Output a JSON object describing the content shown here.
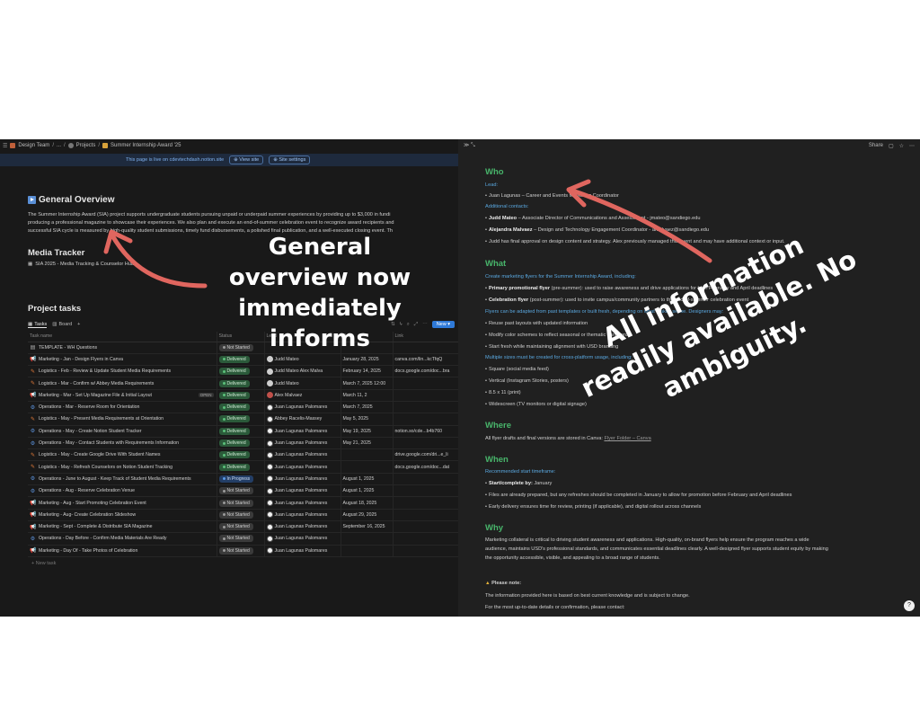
{
  "breadcrumb": [
    "Design Team",
    "...",
    "Projects",
    "Summer Internship Award '25"
  ],
  "live_banner": {
    "text": "This page is live on cdevtechdash.notion.site",
    "view_site": "View site",
    "site_settings": "Site settings"
  },
  "overview": {
    "title": "General Overview",
    "lines": [
      "The Summer Internship Award (SIA) project supports undergraduate students pursuing unpaid or underpaid summer experiences by providing up to $3,000 in fundi",
      "producing a professional magazine to showcase their experiences. We also plan and execute an end-of-summer celebration event to recognize award recipients and",
      "successful SIA cycle is measured by high-quality student submissions, timely fund disbursements, a polished final publication, and a well-executed closing event. Th"
    ]
  },
  "media": {
    "title": "Media Tracker",
    "link": "SIA 2025 - Media Tracking & Counselor Hub"
  },
  "tasks": {
    "title": "Project tasks",
    "tabs": [
      "Tasks",
      "Board",
      "+"
    ],
    "new_button": "New",
    "columns": [
      "Task name",
      "Status",
      "Lead",
      "Due",
      "Link"
    ],
    "rows": [
      {
        "icon": "doc",
        "name": "TEMPLATE - WH Questions",
        "status": "Not Started",
        "lead": "",
        "due": "",
        "link": ""
      },
      {
        "icon": "mega",
        "name": "Marketing - Jan - Design Flyers in Canva",
        "status": "Delivered",
        "lead": "Judd Mateo",
        "due": "January 28, 2025",
        "link": "canva.com/lin...kcTfqQ"
      },
      {
        "icon": "ham",
        "name": "Logistics - Feb - Review & Update Student Media Requirements",
        "status": "Delivered",
        "lead": "Judd Mateo   Alex Malva",
        "due": "February 14, 2025",
        "link": "docs.google.com/doc...bra"
      },
      {
        "icon": "ham",
        "name": "Logistics - Mar - Confirm w/ Abbey Media Requirements",
        "status": "Delivered",
        "lead": "Judd Mateo",
        "due": "March 7, 2025 12:00",
        "link": ""
      },
      {
        "icon": "mega",
        "name": "Marketing - Mar - Set Up Magazine File & Initial Layout",
        "status": "Delivered",
        "lead": "Alex Malvaez",
        "due": "March 11, 2",
        "link": ""
      },
      {
        "icon": "gear",
        "name": "Operations - Mar - Reserve Room for Orientation",
        "status": "Delivered",
        "lead": "Juan Lagunas Palomares",
        "due": "March 7, 2025",
        "link": ""
      },
      {
        "icon": "ham",
        "name": "Logistics - May - Present Media Requirements at Orientation",
        "status": "Delivered",
        "lead": "Abbey Racelis-Massey",
        "due": "May 5, 2025",
        "link": ""
      },
      {
        "icon": "gear",
        "name": "Operations - May - Create Notion Student Tracker",
        "status": "Delivered",
        "lead": "Juan Lagunas Palomares",
        "due": "May 19, 2025",
        "link": "notion.so/cde...b4b760"
      },
      {
        "icon": "gear",
        "name": "Operations - May - Contact Students with Requirements Information",
        "status": "Delivered",
        "lead": "Juan Lagunas Palomares",
        "due": "May 21, 2025",
        "link": ""
      },
      {
        "icon": "ham",
        "name": "Logistics - May - Create Google Drive With Student Names",
        "status": "Delivered",
        "lead": "Juan Lagunas Palomares",
        "due": "",
        "link": "drive.google.com/dri...e_li"
      },
      {
        "icon": "ham",
        "name": "Logistics - May - Refresh Counselors on Notion Student Tracking",
        "status": "Delivered",
        "lead": "Juan Lagunas Palomares",
        "due": "",
        "link": "docs.google.com/doc...dat"
      },
      {
        "icon": "gear",
        "name": "Operations - June to August - Keep Track of Student Media Requirements",
        "status": "In Progress",
        "lead": "Juan Lagunas Palomares",
        "due": "August 1, 2025",
        "link": ""
      },
      {
        "icon": "gear",
        "name": "Operations - Aug - Reserve Celebration Venue",
        "status": "Not Started",
        "lead": "Juan Lagunas Palomares",
        "due": "August 1, 2025",
        "link": ""
      },
      {
        "icon": "mega",
        "name": "Marketing - Aug - Start Promoting Celebration Event",
        "status": "Not Started",
        "lead": "Juan Lagunas Palomares",
        "due": "August 18, 2025",
        "link": ""
      },
      {
        "icon": "mega",
        "name": "Marketing - Aug- Create Celebration Slideshow",
        "status": "Not Started",
        "lead": "Juan Lagunas Palomares",
        "due": "August 29, 2025",
        "link": ""
      },
      {
        "icon": "mega",
        "name": "Marketing - Sept - Complete & Distribute SIA Magazine",
        "status": "Not Started",
        "lead": "Juan Lagunas Palomares",
        "due": "September 16, 2025",
        "link": ""
      },
      {
        "icon": "gear",
        "name": "Operations - Day Before - Confirm Media Materials Are Ready",
        "status": "Not Started",
        "lead": "Juan Lagunas Palomares",
        "due": "",
        "link": ""
      },
      {
        "icon": "mega",
        "name": "Marketing - Day Of - Take Photos of Celebration",
        "status": "Not Started",
        "lead": "Juan Lagunas Palomares",
        "due": "",
        "link": ""
      }
    ],
    "new_task": "+ New task",
    "open_chip": "OPEN"
  },
  "topright": {
    "share": "Share"
  },
  "who": {
    "title": "Who",
    "lead_label": "Lead:",
    "lead": "Juan Lagunas – Career and Events Marketing Coordinator",
    "contacts_label": "Additional contacts:",
    "contacts": [
      {
        "name": "Judd Mateo",
        "rest": " – Associate Director of Communications and Assessment - jmateo@sandiego.edu"
      },
      {
        "name": "Alejandra Malvaez",
        "rest": " – Design and Technology Engagement Coordinator - amalvaez@sandiego.edu"
      },
      {
        "name": "",
        "rest": "Judd has final approval on design content and strategy. Alex previously managed this event and may have additional context or input."
      }
    ]
  },
  "what": {
    "title": "What",
    "create_label": "Create marketing flyers for the Summer Internship Award, including:",
    "flyers": [
      {
        "name": "Primary promotional flyer",
        "rest": " (pre-summer): used to raise awareness and drive applications for both February and April deadlines"
      },
      {
        "name": "Celebration flyer",
        "rest": " (post-summer): used to invite campus/community partners to the end-of-summer celebration event"
      }
    ],
    "adapt_label": "Flyers can be adapted from past templates or built fresh, depending on what makes sense. Designers may:",
    "adapt": [
      "Reuse past layouts with updated information",
      "Modify color schemes to reflect seasonal or thematic variations",
      "Start fresh while maintaining alignment with USD branding"
    ],
    "sizes_label": "Multiple sizes must be created for cross-platform usage, including:",
    "sizes": [
      "Square (social media feed)",
      "Vertical (Instagram Stories, posters)",
      "8.5 x 11 (print)",
      "Widescreen (TV monitors or digital signage)"
    ]
  },
  "where": {
    "title": "Where",
    "text": "All flyer drafts and final versions are stored in Canva: ",
    "link": "Flyer Folder – Canva"
  },
  "when": {
    "title": "When",
    "label": "Recommended start timeframe:",
    "items": [
      {
        "name": "Start/complete by:",
        "rest": " January"
      },
      {
        "name": "",
        "rest": "Files are already prepared, but any refreshes should be completed in January to allow for promotion before February and April deadlines"
      },
      {
        "name": "",
        "rest": "Early delivery ensures time for review, printing (if applicable), and digital rollout across channels"
      }
    ]
  },
  "why": {
    "title": "Why",
    "lines": [
      "Marketing collateral is critical to driving student awareness and applications. High-quality, on-brand flyers help ensure the program reaches a wide",
      "audience, maintains USD's professional standards, and communicates essential deadlines clearly. A well-designed flyer supports student equity by making",
      "the opportunity accessible, visible, and appealing to a broad range of students."
    ]
  },
  "note": {
    "title": "Please note:",
    "lines": [
      "The information provided here is based on best current knowledge and is subject to change.",
      "For the most up-to-date details or confirmation, please contact:"
    ]
  },
  "annotations": {
    "left": "General overview now immediately informs",
    "right": "All information readily available. No ambiguity."
  },
  "colors": {
    "bg": "#191919",
    "green_heading": "#48b56b",
    "blue_label": "#5aa8e0",
    "arrow": "#e0665f"
  }
}
